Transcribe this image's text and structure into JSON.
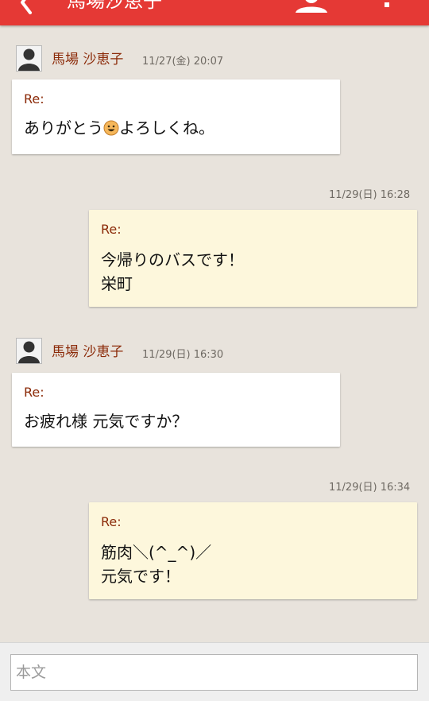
{
  "header": {
    "title": "馬場沙恵子",
    "background_color": "#e53935",
    "back_icon": "chevron-left-icon",
    "contact_icon": "person-icon",
    "more_icon": "more-vert-icon"
  },
  "thread": {
    "background_color": "#e8e3dc",
    "messages": [
      {
        "direction": "incoming",
        "sender": "馬場 沙恵子",
        "timestamp": "11/27(金) 20:07",
        "subject": "Re:",
        "text_before_emoji": "ありがとう",
        "emoji": "smiling-face-emoji",
        "text_after_emoji": "よろしくね。"
      },
      {
        "direction": "outgoing",
        "timestamp": "11/29(日) 16:28",
        "subject": "Re:",
        "lines": [
          "今帰りのバスです！",
          "栄町"
        ]
      },
      {
        "direction": "incoming",
        "sender": "馬場 沙恵子",
        "timestamp": "11/29(日) 16:30",
        "subject": "Re:",
        "lines": [
          "お疲れ様 元気ですか？"
        ]
      },
      {
        "direction": "outgoing",
        "timestamp": "11/29(日) 16:34",
        "subject": "Re:",
        "lines": [
          "筋肉＼(^_^)／",
          "元気です！"
        ]
      }
    ]
  },
  "compose": {
    "placeholder": "本文",
    "value": ""
  },
  "colors": {
    "incoming_bubble": "#ffffff",
    "outgoing_bubble": "#fdf7dc",
    "sender_name": "#8b2a08",
    "subject": "#8b2a08"
  }
}
